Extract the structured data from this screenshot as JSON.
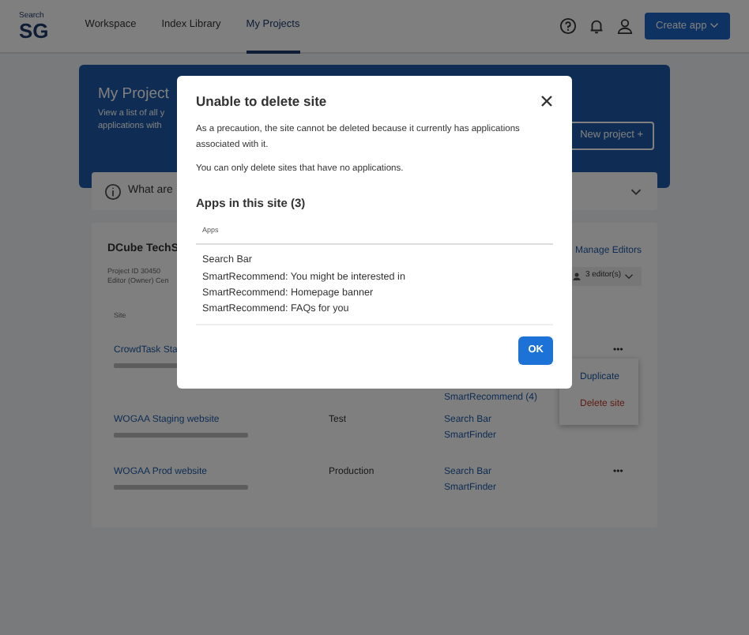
{
  "logo": {
    "top": "Search",
    "bottom": "SG"
  },
  "nav": [
    {
      "label": "Workspace",
      "selected": false
    },
    {
      "label": "Index Library",
      "selected": false
    },
    {
      "label": "My Projects",
      "selected": true
    }
  ],
  "create_button": "Create app",
  "banner": {
    "title": "My Project",
    "lines": [
      "View a list of all y",
      "applications with"
    ],
    "button": "New project +"
  },
  "info_bar": {
    "text": "What are"
  },
  "project": {
    "name": "DCube TechS",
    "manage": "Manage Editors",
    "meta": [
      "Project ID 30450",
      "Editor (Owner) Cen"
    ],
    "editors": "3 editor(s)",
    "column": "Site",
    "sites": [
      {
        "name": "CrowdTask Sta",
        "apps": [
          "SmartRecommend (4)"
        ],
        "more": "•••"
      },
      {
        "name": "WOGAA Staging website",
        "env": "Test",
        "apps": [
          "Search Bar",
          "SmartFinder"
        ]
      },
      {
        "name": "WOGAA Prod website",
        "env": "Production",
        "apps": [
          "Search Bar",
          "SmartFinder"
        ],
        "more": "•••"
      }
    ],
    "menu": [
      "Duplicate",
      "Delete site"
    ]
  },
  "modal": {
    "title": "Unable to delete site",
    "paragraphs": [
      "As a precaution, the site cannot be deleted because it currently has applications associated with it.",
      "You can only delete sites that have no applications."
    ],
    "subtitle": "Apps in this site (3)",
    "column": "Apps",
    "apps": [
      "Search Bar",
      "SmartRecommend: You might be interested in",
      "SmartRecommend: Homepage banner",
      "SmartRecommend: FAQs for you"
    ],
    "button": "OK"
  }
}
